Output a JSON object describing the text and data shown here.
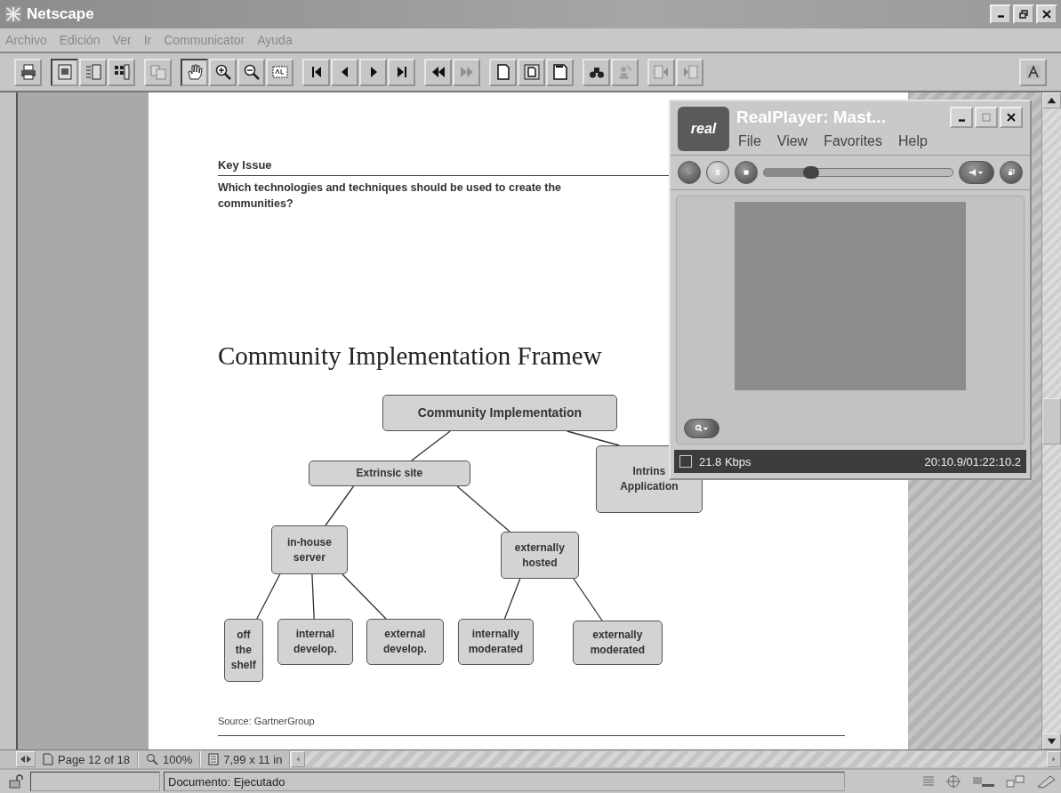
{
  "window": {
    "title": "Netscape"
  },
  "menu": [
    "Archivo",
    "Edición",
    "Ver",
    "Ir",
    "Communicator",
    "Ayuda"
  ],
  "toolbar_groups": [
    {
      "buttons": [
        {
          "kind": "print",
          "selected": false,
          "disabled": false
        }
      ]
    },
    {
      "buttons": [
        {
          "kind": "single",
          "selected": true,
          "disabled": false
        },
        {
          "kind": "continuous",
          "selected": false,
          "disabled": false
        },
        {
          "kind": "facing",
          "selected": false,
          "disabled": false
        }
      ]
    },
    {
      "buttons": [
        {
          "kind": "copy",
          "selected": false,
          "disabled": true
        }
      ]
    },
    {
      "buttons": [
        {
          "kind": "hand",
          "selected": true,
          "disabled": false
        },
        {
          "kind": "zoomin",
          "selected": false,
          "disabled": false
        },
        {
          "kind": "zoomout",
          "selected": false,
          "disabled": false
        },
        {
          "kind": "textselect",
          "selected": false,
          "disabled": false
        }
      ]
    },
    {
      "buttons": [
        {
          "kind": "first",
          "selected": false,
          "disabled": false
        },
        {
          "kind": "prev",
          "selected": false,
          "disabled": false
        },
        {
          "kind": "next",
          "selected": false,
          "disabled": false
        },
        {
          "kind": "last",
          "selected": false,
          "disabled": false
        }
      ]
    },
    {
      "buttons": [
        {
          "kind": "back",
          "selected": false,
          "disabled": false
        },
        {
          "kind": "forward",
          "selected": false,
          "disabled": true
        }
      ]
    },
    {
      "buttons": [
        {
          "kind": "actual",
          "selected": false,
          "disabled": false
        },
        {
          "kind": "fitpage",
          "selected": false,
          "disabled": false
        },
        {
          "kind": "fitwidth",
          "selected": false,
          "disabled": false
        }
      ]
    },
    {
      "buttons": [
        {
          "kind": "find",
          "selected": false,
          "disabled": false
        },
        {
          "kind": "search",
          "selected": false,
          "disabled": true
        }
      ]
    },
    {
      "buttons": [
        {
          "kind": "prevdoc",
          "selected": false,
          "disabled": true
        },
        {
          "kind": "nextdoc",
          "selected": false,
          "disabled": true
        }
      ]
    }
  ],
  "document": {
    "key_issue_label": "Key Issue",
    "key_issue_question": "Which technologies and techniques should be used to create the\ncommunities?",
    "heading": "Community Implementation Framew",
    "diagram": {
      "label": "Community Implementation",
      "children": [
        {
          "label": "Extrinsic site",
          "children": [
            {
              "label": "in-house\nserver",
              "children": [
                {
                  "label": "off\nthe\nshelf"
                },
                {
                  "label": "internal\ndevelop."
                },
                {
                  "label": "external\ndevelop."
                }
              ]
            },
            {
              "label": "externally\nhosted",
              "children": [
                {
                  "label": "internally\nmoderated"
                },
                {
                  "label": "externally\nmoderated"
                }
              ]
            }
          ]
        },
        {
          "label": "Intrins\nApplication"
        }
      ]
    },
    "source": "Source: GartnerGroup"
  },
  "pdf_bar": {
    "page": "Page 12 of 18",
    "zoom": "100%",
    "size": "7,99 x 11 in"
  },
  "status_bar": {
    "text": "Documento: Ejecutado"
  },
  "realplayer": {
    "title": "RealPlayer: Mast...",
    "logo_text": "real",
    "menu": [
      "File",
      "View",
      "Favorites",
      "Help"
    ],
    "position": {
      "level": 0.25
    },
    "bitrate": "21.8 Kbps",
    "time": "20:10.9/01:22:10.2"
  }
}
